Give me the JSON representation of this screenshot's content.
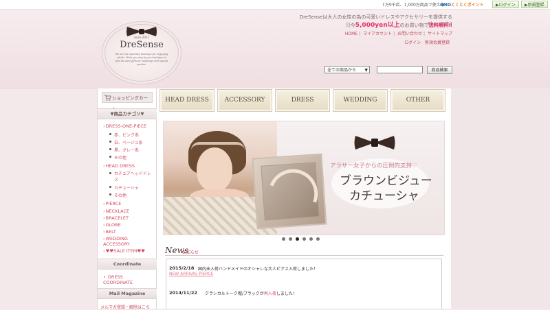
{
  "topbar": {
    "gmo_text": "1万9千店、1,000万商品で使える",
    "gmo_logo_blue": "GMO",
    "gmo_logo_orange": "とくとくポイント",
    "login_label": "ログイン",
    "register_label": "新規登録"
  },
  "logo": {
    "since": "since 2011",
    "brand": "DreSense",
    "tagline": "We are the specialty boutique for engaging adults. Wish you step by our boutique to find the best gifts for weddings and special parties."
  },
  "header": {
    "intro_line1": "DreSenseは大人の女性の為の可愛いドレスやアクセサリーを提供するShopです♪",
    "intro_pre": "只今",
    "intro_amount": "5,000yen以上",
    "intro_mid": "のお買い物で",
    "intro_free": "送料無料!!",
    "nav": [
      "HOME",
      "マイアカウント",
      "お問い合わせ",
      "サイトマップ"
    ],
    "nav2": [
      "ログイン",
      "新規会員登録"
    ],
    "search_select": "全ての商品から",
    "search_button": "商品検索"
  },
  "sidebar": {
    "cart_label": "ショッピングカート",
    "category_heading": "▼商品カテゴリ▼",
    "categories": [
      {
        "label": "DRESS-ONE-PIECE",
        "subs": [
          "赤、ピンク系",
          "白、ベージュ系",
          "黒、グレー系",
          "その他"
        ]
      },
      {
        "label": "HEAD DRESS",
        "subs": [
          "カチュアヘッドドレス",
          "カチューシャ",
          "その他"
        ]
      },
      {
        "label": "PIERCE",
        "subs": []
      },
      {
        "label": "NECKLACE",
        "subs": []
      },
      {
        "label": "BRACELET",
        "subs": []
      },
      {
        "label": "GLOBE",
        "subs": []
      },
      {
        "label": "BELT",
        "subs": []
      },
      {
        "label": "WEDDING ACCESSORY",
        "subs": []
      },
      {
        "label": "♥♥SALE ITEM♥♥",
        "subs": []
      }
    ],
    "coordinate_heading": "Coordinate",
    "coordinate_item": "DRESS COORDINATE",
    "mail_heading": "Mail Magazine",
    "mail_text": "メルマガ登録・解除はこち"
  },
  "tabs": [
    "HEAD DRESS",
    "ACCESSORY",
    "DRESS",
    "WEDDING",
    "OTHER"
  ],
  "slider": {
    "subtitle": "アラサー女子からの圧倒的支持♡",
    "title_line1": "ブラウンビジュー",
    "title_line2": "カチューシャ",
    "slide_count": 6,
    "active_slide": 3
  },
  "news": {
    "title": "News",
    "subtitle": "お知らせ",
    "items": [
      {
        "date": "2015/2/18",
        "text": "国内未入荷ハンドメイドのオシャレな大人ピアス入荷しました！",
        "link": "NEW ARRIVAL PIERCE"
      },
      {
        "date": "2014/11/22",
        "text_before": "クラシカルトーク帽/ブラックが",
        "text_emph": "再入荷",
        "text_after": "しました！"
      }
    ]
  },
  "colors": {
    "accent": "#d04a5e",
    "header_bg": "#f3e9ea",
    "tab_bg": "#ece3cf"
  }
}
